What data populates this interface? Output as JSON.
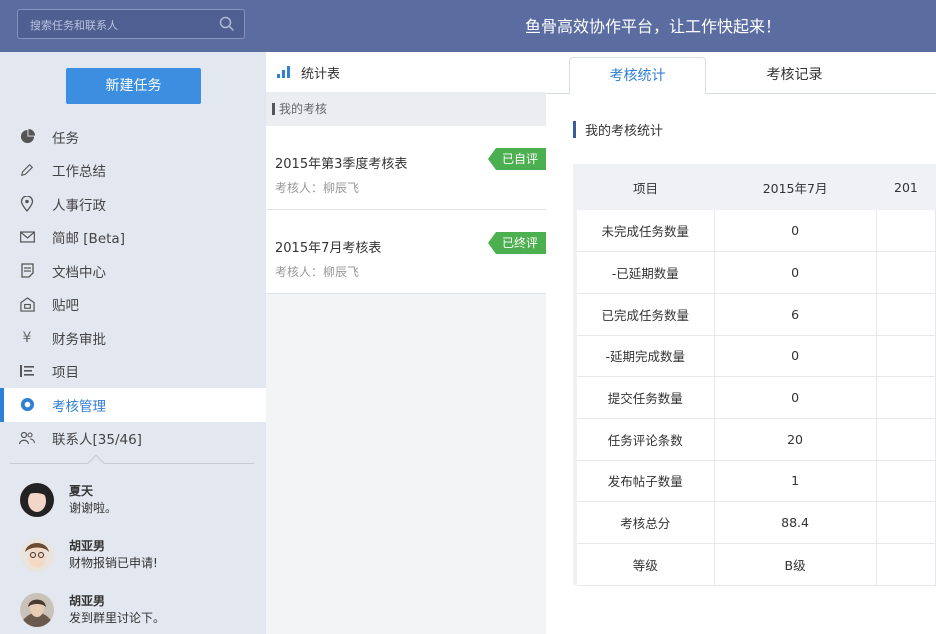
{
  "search": {
    "placeholder": "搜索任务和联系人"
  },
  "header": {
    "slogan": "鱼骨高效协作平台，让工作快起来！"
  },
  "sidebar": {
    "new_task_label": "新建任务",
    "items": [
      {
        "label": "任务",
        "icon": "pie-chart-icon"
      },
      {
        "label": "工作总结",
        "icon": "pencil-icon"
      },
      {
        "label": "人事行政",
        "icon": "location-pin-icon"
      },
      {
        "label": "简邮 [Beta]",
        "icon": "envelope-icon"
      },
      {
        "label": "文档中心",
        "icon": "document-icon"
      },
      {
        "label": "贴吧",
        "icon": "building-icon"
      },
      {
        "label": "财务审批",
        "icon": "yen-icon"
      },
      {
        "label": "项目",
        "icon": "list-icon"
      },
      {
        "label": "考核管理",
        "icon": "target-icon",
        "active": true
      },
      {
        "label": "联系人[35/46]",
        "icon": "contacts-icon"
      }
    ],
    "chats": [
      {
        "name": "夏天",
        "message": "谢谢啦。"
      },
      {
        "name": "胡亚男",
        "message": "财物报销已申请!"
      },
      {
        "name": "胡亚男",
        "message": "发到群里讨论下。"
      }
    ]
  },
  "middle": {
    "header": "统计表",
    "section": "我的考核",
    "items": [
      {
        "title": "2015年第3季度考核表",
        "reviewer": "考核人：柳辰飞",
        "tag": "已自评",
        "tag_color": "#4caf50"
      },
      {
        "title": "2015年7月考核表",
        "reviewer": "考核人：柳辰飞",
        "tag": "已终评",
        "tag_color": "#4caf50"
      }
    ]
  },
  "main": {
    "tabs": [
      "考核统计",
      "考核记录"
    ],
    "section_title": "我的考核统计",
    "table": {
      "headers": [
        "项目",
        "2015年7月",
        "201"
      ],
      "rows": [
        [
          "未完成任务数量",
          "0",
          ""
        ],
        [
          "-已延期数量",
          "0",
          ""
        ],
        [
          "已完成任务数量",
          "6",
          ""
        ],
        [
          "-延期完成数量",
          "0",
          ""
        ],
        [
          "提交任务数量",
          "0",
          ""
        ],
        [
          "任务评论条数",
          "20",
          ""
        ],
        [
          "发布帖子数量",
          "1",
          ""
        ],
        [
          "考核总分",
          "88.4",
          ""
        ],
        [
          "等级",
          "B级",
          ""
        ]
      ]
    }
  },
  "colors": {
    "topbar": "#5b6da0",
    "accent": "#2f7fd4",
    "new_task": "#3c8fe0",
    "tag": "#4caf50"
  }
}
